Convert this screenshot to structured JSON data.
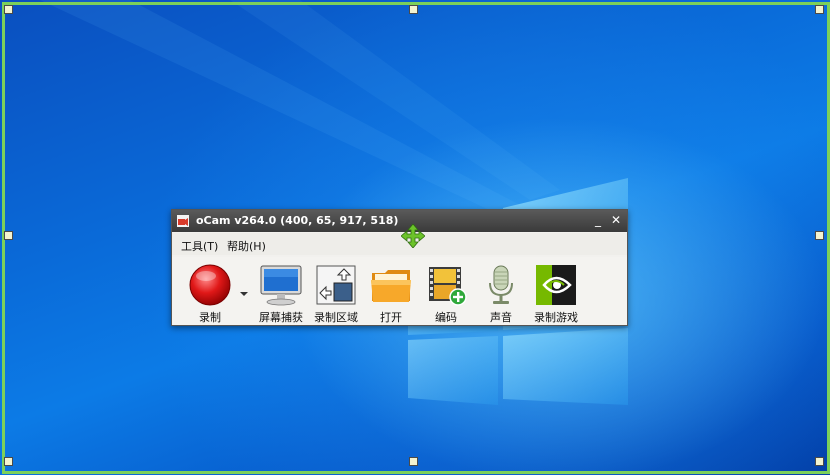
{
  "window": {
    "title": "oCam v264.0 (400, 65, 917, 518)",
    "minimize_glyph": "_",
    "close_glyph": "✕"
  },
  "menu": {
    "items": [
      {
        "label": "工具(T)"
      },
      {
        "label": "帮助(H)"
      }
    ]
  },
  "toolbar": {
    "items": [
      {
        "label": "录制",
        "icon": "record-icon"
      },
      {
        "label": "屏幕捕获",
        "icon": "monitor-icon"
      },
      {
        "label": "录制区域",
        "icon": "region-icon"
      },
      {
        "label": "打开",
        "icon": "folder-icon"
      },
      {
        "label": "编码",
        "icon": "film-add-icon"
      },
      {
        "label": "声音",
        "icon": "microphone-icon"
      },
      {
        "label": "录制游戏",
        "icon": "game-icon"
      }
    ]
  },
  "colors": {
    "region_border": "#7cd05a",
    "titlebar": "#3a3a3a",
    "record_red": "#e01818",
    "desktop_blue": "#0a6ad8"
  }
}
